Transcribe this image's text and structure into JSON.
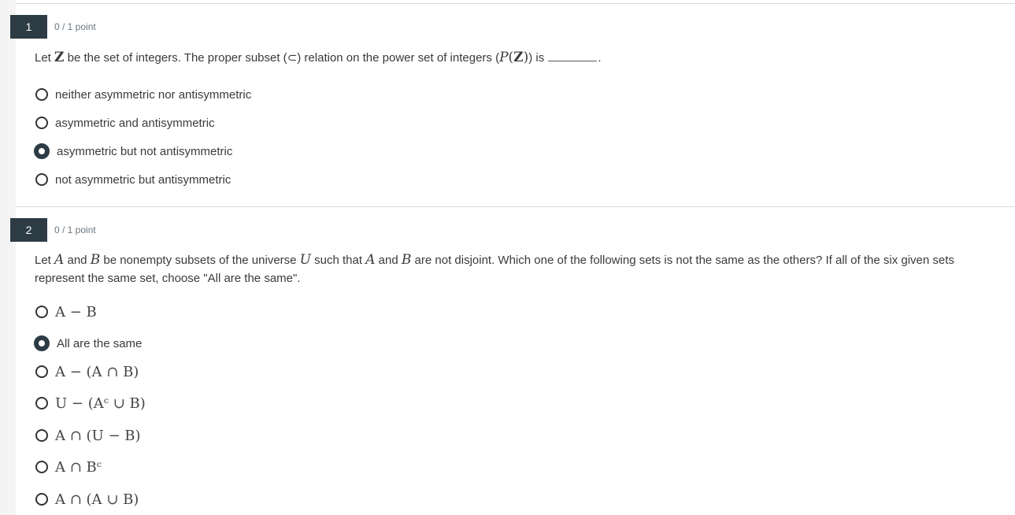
{
  "questions": [
    {
      "number": "1",
      "points": "0 / 1 point",
      "text": {
        "p1": "Let ",
        "Z": "Z",
        "p2": " be the set of integers. The proper subset (",
        "subset_symbol": "⊂",
        "p3": ") relation on the power set of integers (",
        "P": "P",
        "paren_open": "(",
        "Z2": "Z",
        "paren_close": ")",
        "p4": ") is ",
        "p5": "."
      },
      "options": [
        {
          "label": "neither asymmetric nor antisymmetric",
          "selected": false
        },
        {
          "label": "asymmetric and antisymmetric",
          "selected": false
        },
        {
          "label": "asymmetric but not antisymmetric",
          "selected": true
        },
        {
          "label": "not asymmetric but antisymmetric",
          "selected": false
        }
      ]
    },
    {
      "number": "2",
      "points": "0 / 1 point",
      "text": {
        "p1": "Let ",
        "A": "A",
        "p2": " and ",
        "B": "B",
        "p3": " be nonempty subsets of the universe ",
        "U": "U",
        "p4": " such that ",
        "A2": "A",
        "p5": " and ",
        "B2": "B",
        "p6": " are not disjoint.  Which one of the following sets is not the same as the others?  If all of the six given sets represent the same set, choose \"All are the same\"."
      },
      "options": [
        {
          "label": "A − B",
          "selected": false,
          "math": true
        },
        {
          "label": "All are the same",
          "selected": true,
          "math": false
        },
        {
          "label": "A − (A ∩ B)",
          "selected": false,
          "math": true
        },
        {
          "label": "U − (Aᶜ ∪ B)",
          "selected": false,
          "math": true
        },
        {
          "label": "A ∩ (U − B)",
          "selected": false,
          "math": true
        },
        {
          "label": "A ∩ Bᶜ",
          "selected": false,
          "math": true
        },
        {
          "label": "A ∩ (A ∪ B)",
          "selected": false,
          "math": true
        }
      ]
    }
  ]
}
